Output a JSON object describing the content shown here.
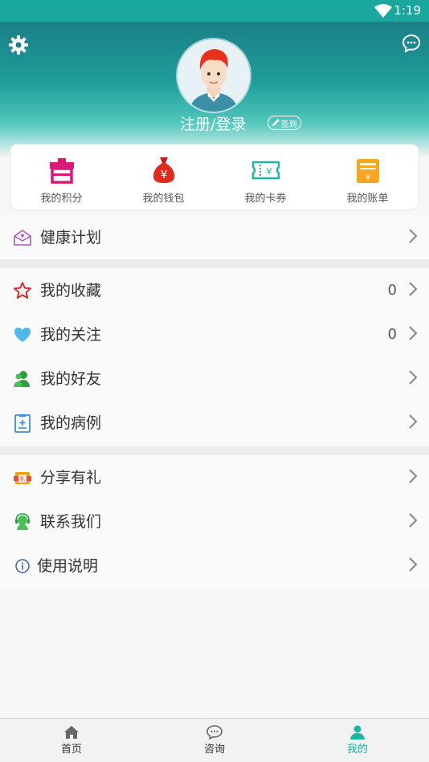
{
  "status_bar": {
    "time": "1:19"
  },
  "header": {
    "login_label": "注册/登录",
    "signin_label": "签到"
  },
  "quick_actions": [
    {
      "label": "我的积分",
      "icon": "gift-box-icon"
    },
    {
      "label": "我的钱包",
      "icon": "money-bag-icon"
    },
    {
      "label": "我的卡券",
      "icon": "ticket-icon"
    },
    {
      "label": "我的账单",
      "icon": "bill-icon"
    }
  ],
  "menu": {
    "health_plan": "健康计划",
    "favorites": {
      "label": "我的收藏",
      "count": "0"
    },
    "following": {
      "label": "我的关注",
      "count": "0"
    },
    "friends": "我的好友",
    "cases": "我的病例",
    "share": "分享有礼",
    "contact": "联系我们",
    "instructions": "使用说明"
  },
  "tabs": [
    {
      "label": "首页",
      "active": false
    },
    {
      "label": "咨询",
      "active": false
    },
    {
      "label": "我的",
      "active": true
    }
  ],
  "colors": {
    "accent": "#1cb6a6",
    "header_top": "#1a7f86",
    "status_bar": "#1aa89e"
  }
}
